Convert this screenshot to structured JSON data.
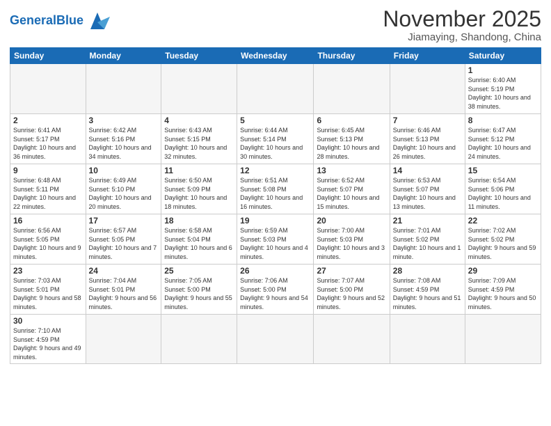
{
  "header": {
    "logo_general": "General",
    "logo_blue": "Blue",
    "month_title": "November 2025",
    "location": "Jiamaying, Shandong, China"
  },
  "weekdays": [
    "Sunday",
    "Monday",
    "Tuesday",
    "Wednesday",
    "Thursday",
    "Friday",
    "Saturday"
  ],
  "weeks": [
    [
      {
        "day": "",
        "info": ""
      },
      {
        "day": "",
        "info": ""
      },
      {
        "day": "",
        "info": ""
      },
      {
        "day": "",
        "info": ""
      },
      {
        "day": "",
        "info": ""
      },
      {
        "day": "",
        "info": ""
      },
      {
        "day": "1",
        "info": "Sunrise: 6:40 AM\nSunset: 5:19 PM\nDaylight: 10 hours\nand 38 minutes."
      }
    ],
    [
      {
        "day": "2",
        "info": "Sunrise: 6:41 AM\nSunset: 5:17 PM\nDaylight: 10 hours\nand 36 minutes."
      },
      {
        "day": "3",
        "info": "Sunrise: 6:42 AM\nSunset: 5:16 PM\nDaylight: 10 hours\nand 34 minutes."
      },
      {
        "day": "4",
        "info": "Sunrise: 6:43 AM\nSunset: 5:15 PM\nDaylight: 10 hours\nand 32 minutes."
      },
      {
        "day": "5",
        "info": "Sunrise: 6:44 AM\nSunset: 5:14 PM\nDaylight: 10 hours\nand 30 minutes."
      },
      {
        "day": "6",
        "info": "Sunrise: 6:45 AM\nSunset: 5:13 PM\nDaylight: 10 hours\nand 28 minutes."
      },
      {
        "day": "7",
        "info": "Sunrise: 6:46 AM\nSunset: 5:13 PM\nDaylight: 10 hours\nand 26 minutes."
      },
      {
        "day": "8",
        "info": "Sunrise: 6:47 AM\nSunset: 5:12 PM\nDaylight: 10 hours\nand 24 minutes."
      }
    ],
    [
      {
        "day": "9",
        "info": "Sunrise: 6:48 AM\nSunset: 5:11 PM\nDaylight: 10 hours\nand 22 minutes."
      },
      {
        "day": "10",
        "info": "Sunrise: 6:49 AM\nSunset: 5:10 PM\nDaylight: 10 hours\nand 20 minutes."
      },
      {
        "day": "11",
        "info": "Sunrise: 6:50 AM\nSunset: 5:09 PM\nDaylight: 10 hours\nand 18 minutes."
      },
      {
        "day": "12",
        "info": "Sunrise: 6:51 AM\nSunset: 5:08 PM\nDaylight: 10 hours\nand 16 minutes."
      },
      {
        "day": "13",
        "info": "Sunrise: 6:52 AM\nSunset: 5:07 PM\nDaylight: 10 hours\nand 15 minutes."
      },
      {
        "day": "14",
        "info": "Sunrise: 6:53 AM\nSunset: 5:07 PM\nDaylight: 10 hours\nand 13 minutes."
      },
      {
        "day": "15",
        "info": "Sunrise: 6:54 AM\nSunset: 5:06 PM\nDaylight: 10 hours\nand 11 minutes."
      }
    ],
    [
      {
        "day": "16",
        "info": "Sunrise: 6:56 AM\nSunset: 5:05 PM\nDaylight: 10 hours\nand 9 minutes."
      },
      {
        "day": "17",
        "info": "Sunrise: 6:57 AM\nSunset: 5:05 PM\nDaylight: 10 hours\nand 7 minutes."
      },
      {
        "day": "18",
        "info": "Sunrise: 6:58 AM\nSunset: 5:04 PM\nDaylight: 10 hours\nand 6 minutes."
      },
      {
        "day": "19",
        "info": "Sunrise: 6:59 AM\nSunset: 5:03 PM\nDaylight: 10 hours\nand 4 minutes."
      },
      {
        "day": "20",
        "info": "Sunrise: 7:00 AM\nSunset: 5:03 PM\nDaylight: 10 hours\nand 3 minutes."
      },
      {
        "day": "21",
        "info": "Sunrise: 7:01 AM\nSunset: 5:02 PM\nDaylight: 10 hours\nand 1 minute."
      },
      {
        "day": "22",
        "info": "Sunrise: 7:02 AM\nSunset: 5:02 PM\nDaylight: 9 hours\nand 59 minutes."
      }
    ],
    [
      {
        "day": "23",
        "info": "Sunrise: 7:03 AM\nSunset: 5:01 PM\nDaylight: 9 hours\nand 58 minutes."
      },
      {
        "day": "24",
        "info": "Sunrise: 7:04 AM\nSunset: 5:01 PM\nDaylight: 9 hours\nand 56 minutes."
      },
      {
        "day": "25",
        "info": "Sunrise: 7:05 AM\nSunset: 5:00 PM\nDaylight: 9 hours\nand 55 minutes."
      },
      {
        "day": "26",
        "info": "Sunrise: 7:06 AM\nSunset: 5:00 PM\nDaylight: 9 hours\nand 54 minutes."
      },
      {
        "day": "27",
        "info": "Sunrise: 7:07 AM\nSunset: 5:00 PM\nDaylight: 9 hours\nand 52 minutes."
      },
      {
        "day": "28",
        "info": "Sunrise: 7:08 AM\nSunset: 4:59 PM\nDaylight: 9 hours\nand 51 minutes."
      },
      {
        "day": "29",
        "info": "Sunrise: 7:09 AM\nSunset: 4:59 PM\nDaylight: 9 hours\nand 50 minutes."
      }
    ],
    [
      {
        "day": "30",
        "info": "Sunrise: 7:10 AM\nSunset: 4:59 PM\nDaylight: 9 hours\nand 49 minutes."
      },
      {
        "day": "",
        "info": ""
      },
      {
        "day": "",
        "info": ""
      },
      {
        "day": "",
        "info": ""
      },
      {
        "day": "",
        "info": ""
      },
      {
        "day": "",
        "info": ""
      },
      {
        "day": "",
        "info": ""
      }
    ]
  ]
}
